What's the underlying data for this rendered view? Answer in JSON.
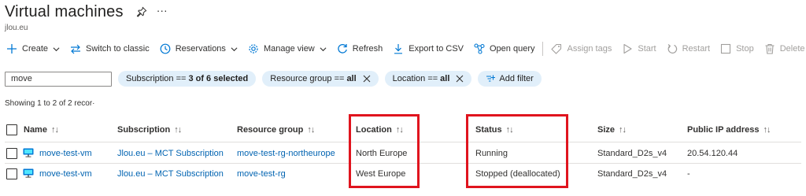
{
  "header": {
    "title": "Virtual machines",
    "more_glyph": "···",
    "subtitle": "jlou.eu"
  },
  "toolbar": {
    "create": "Create",
    "switch_classic": "Switch to classic",
    "reservations": "Reservations",
    "manage_view": "Manage view",
    "refresh": "Refresh",
    "export_csv": "Export to CSV",
    "open_query": "Open query",
    "assign_tags": "Assign tags",
    "start": "Start",
    "restart": "Restart",
    "stop": "Stop",
    "delete": "Delete"
  },
  "filters": {
    "search_value": "move",
    "subscription_prefix": "Subscription ==",
    "subscription_value": "3 of 6 selected",
    "resource_group_prefix": "Resource group ==",
    "resource_group_value": "all",
    "location_prefix": "Location ==",
    "location_value": "all",
    "add_filter": "Add filter"
  },
  "showing_text": "Showing 1 to 2 of 2 recor·",
  "table": {
    "sort_glyph": "↑↓",
    "columns": {
      "name": "Name",
      "subscription": "Subscription",
      "resource_group": "Resource group",
      "location": "Location",
      "status": "Status",
      "size": "Size",
      "public_ip": "Public IP address"
    },
    "rows": [
      {
        "name": "move-test-vm",
        "subscription": "Jlou.eu – MCT Subscription",
        "resource_group": "move-test-rg-northeurope",
        "location": "North Europe",
        "status": "Running",
        "size": "Standard_D2s_v4",
        "public_ip": "20.54.120.44"
      },
      {
        "name": "move-test-vm",
        "subscription": "Jlou.eu – MCT Subscription",
        "resource_group": "move-test-rg",
        "location": "West Europe",
        "status": "Stopped (deallocated)",
        "size": "Standard_D2s_v4",
        "public_ip": "-"
      }
    ]
  },
  "icons": [
    "pin-icon",
    "plus-icon",
    "switch-icon",
    "clock-icon",
    "gear-icon",
    "refresh-icon",
    "download-icon",
    "query-icon",
    "tag-icon",
    "play-icon",
    "restart-icon",
    "stop-icon",
    "trash-icon",
    "close-icon",
    "add-filter-icon",
    "vm-icon"
  ],
  "colors": {
    "accent": "#0078d4",
    "link": "#0063b1",
    "pill_bg": "#e1effa",
    "highlight": "#e0141e",
    "disabled": "#a19f9d"
  }
}
